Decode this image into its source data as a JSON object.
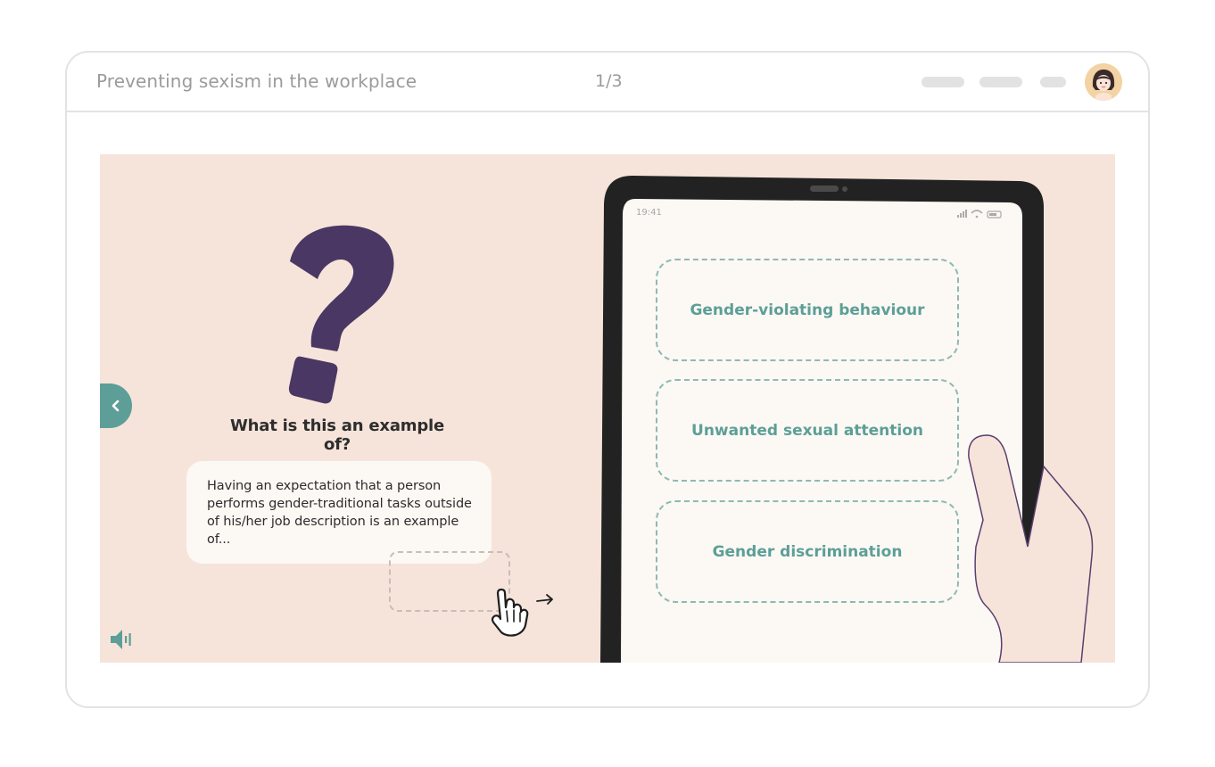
{
  "header": {
    "course_title": "Preventing sexism in the workplace",
    "progress": "1/3"
  },
  "slide": {
    "question": "What is this an example of?",
    "scenario": "Having an expectation that a person performs gender-traditional tasks outside of his/her job description is an example of...",
    "phone_time": "19:41",
    "options": [
      {
        "label": "Gender-violating behaviour"
      },
      {
        "label": "Unwanted sexual attention"
      },
      {
        "label": "Gender discrimination"
      }
    ]
  },
  "icons": {
    "back": "chevron-left-icon",
    "audio": "speaker-icon",
    "drag_hint": "pointer-hand-icon",
    "avatar": "user-avatar"
  },
  "colors": {
    "accent": "#5e9e98",
    "question_mark": "#4a3763",
    "stage_background": "#f6e4da"
  }
}
